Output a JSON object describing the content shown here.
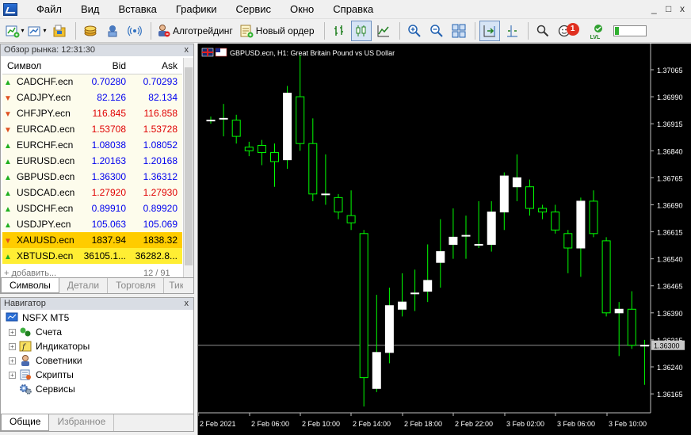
{
  "menu": [
    "Файл",
    "Вид",
    "Вставка",
    "Графики",
    "Сервис",
    "Окно",
    "Справка"
  ],
  "window_controls": [
    "_",
    "□",
    "x"
  ],
  "toolbar": {
    "algo_label": "Алготрейдинг",
    "new_order_label": "Новый ордер",
    "lvl_label": "LVL",
    "notification_count": "1"
  },
  "market_watch": {
    "title": "Обзор рынка: 12:31:30",
    "close": "x",
    "columns": [
      "Символ",
      "Bid",
      "Ask"
    ],
    "rows": [
      {
        "symbol": "CADCHF.ecn",
        "bid": "0.70280",
        "ask": "0.70293",
        "dir": "up",
        "color": "blue"
      },
      {
        "symbol": "CADJPY.ecn",
        "bid": "82.126",
        "ask": "82.134",
        "dir": "down",
        "color": "blue"
      },
      {
        "symbol": "CHFJPY.ecn",
        "bid": "116.845",
        "ask": "116.858",
        "dir": "down",
        "color": "red"
      },
      {
        "symbol": "EURCAD.ecn",
        "bid": "1.53708",
        "ask": "1.53728",
        "dir": "down",
        "color": "red"
      },
      {
        "symbol": "EURCHF.ecn",
        "bid": "1.08038",
        "ask": "1.08052",
        "dir": "up",
        "color": "blue"
      },
      {
        "symbol": "EURUSD.ecn",
        "bid": "1.20163",
        "ask": "1.20168",
        "dir": "up",
        "color": "blue"
      },
      {
        "symbol": "GBPUSD.ecn",
        "bid": "1.36300",
        "ask": "1.36312",
        "dir": "up",
        "color": "blue"
      },
      {
        "symbol": "USDCAD.ecn",
        "bid": "1.27920",
        "ask": "1.27930",
        "dir": "up",
        "color": "red"
      },
      {
        "symbol": "USDCHF.ecn",
        "bid": "0.89910",
        "ask": "0.89920",
        "dir": "up",
        "color": "blue"
      },
      {
        "symbol": "USDJPY.ecn",
        "bid": "105.063",
        "ask": "105.069",
        "dir": "up",
        "color": "blue"
      },
      {
        "symbol": "XAUUSD.ecn",
        "bid": "1837.94",
        "ask": "1838.32",
        "dir": "down",
        "color": "blk",
        "highlight": "xau"
      },
      {
        "symbol": "XBTUSD.ecn",
        "bid": "36105.1...",
        "ask": "36282.8...",
        "dir": "up",
        "color": "blk",
        "highlight": "xbt"
      }
    ],
    "add_label": "+ добавить...",
    "pager": "12 / 91",
    "tabs": [
      "Символы",
      "Детали",
      "Торговля",
      "Тики"
    ]
  },
  "navigator": {
    "title": "Навигатор",
    "close": "x",
    "root": "NSFX MT5",
    "items": [
      "Счета",
      "Индикаторы",
      "Советники",
      "Скрипты",
      "Сервисы"
    ],
    "tabs": [
      "Общие",
      "Избранное"
    ]
  },
  "chart": {
    "title": "GBPUSD.ecn, H1:  Great Britain Pound vs US Dollar",
    "bg_color": "#000000",
    "bull_color": "#ffffff",
    "wick_color": "#00ff00",
    "current_price": "1.36300",
    "price_ticks": [
      "1.37065",
      "1.36990",
      "1.36915",
      "1.36840",
      "1.36765",
      "1.36690",
      "1.36615",
      "1.36540",
      "1.36465",
      "1.36390",
      "1.36315",
      "1.36240",
      "1.36165"
    ],
    "time_ticks": [
      "2 Feb 2021",
      "2 Feb 06:00",
      "2 Feb 10:00",
      "2 Feb 14:00",
      "2 Feb 18:00",
      "2 Feb 22:00",
      "3 Feb 02:00",
      "3 Feb 06:00",
      "3 Feb 10:00"
    ]
  },
  "chart_data": {
    "type": "candlestick",
    "title": "GBPUSD.ecn, H1:  Great Britain Pound vs US Dollar",
    "xlabel": "",
    "ylabel": "",
    "ylim": [
      1.3613,
      1.3712
    ],
    "candles": [
      {
        "o": 1.36925,
        "c": 1.36925,
        "h": 1.36935,
        "l": 1.36915
      },
      {
        "o": 1.3693,
        "c": 1.3693,
        "h": 1.3697,
        "l": 1.3688
      },
      {
        "o": 1.36925,
        "c": 1.3688,
        "h": 1.3694,
        "l": 1.3686
      },
      {
        "o": 1.3685,
        "c": 1.3684,
        "h": 1.36865,
        "l": 1.36825
      },
      {
        "o": 1.36855,
        "c": 1.36835,
        "h": 1.3687,
        "l": 1.368
      },
      {
        "o": 1.36835,
        "c": 1.3681,
        "h": 1.3686,
        "l": 1.3674
      },
      {
        "o": 1.36815,
        "c": 1.37,
        "h": 1.3702,
        "l": 1.3679
      },
      {
        "o": 1.3699,
        "c": 1.3686,
        "h": 1.37105,
        "l": 1.3684
      },
      {
        "o": 1.3686,
        "c": 1.3672,
        "h": 1.3693,
        "l": 1.367
      },
      {
        "o": 1.3672,
        "c": 1.3672,
        "h": 1.3683,
        "l": 1.3669
      },
      {
        "o": 1.3671,
        "c": 1.3667,
        "h": 1.3672,
        "l": 1.3665
      },
      {
        "o": 1.3666,
        "c": 1.3664,
        "h": 1.3673,
        "l": 1.3662
      },
      {
        "o": 1.3661,
        "c": 1.3621,
        "h": 1.3662,
        "l": 1.3613
      },
      {
        "o": 1.3618,
        "c": 1.3628,
        "h": 1.3644,
        "l": 1.3617
      },
      {
        "o": 1.3628,
        "c": 1.3641,
        "h": 1.3646,
        "l": 1.3625
      },
      {
        "o": 1.364,
        "c": 1.3642,
        "h": 1.365,
        "l": 1.3638
      },
      {
        "o": 1.36445,
        "c": 1.36445,
        "h": 1.3651,
        "l": 1.36395
      },
      {
        "o": 1.3645,
        "c": 1.3648,
        "h": 1.3658,
        "l": 1.3642
      },
      {
        "o": 1.3653,
        "c": 1.3656,
        "h": 1.3665,
        "l": 1.3646
      },
      {
        "o": 1.3658,
        "c": 1.366,
        "h": 1.3668,
        "l": 1.3654
      },
      {
        "o": 1.36605,
        "c": 1.36605,
        "h": 1.3666,
        "l": 1.3654
      },
      {
        "o": 1.3658,
        "c": 1.3658,
        "h": 1.367,
        "l": 1.3657
      },
      {
        "o": 1.3658,
        "c": 1.3667,
        "h": 1.367,
        "l": 1.3656
      },
      {
        "o": 1.3667,
        "c": 1.3677,
        "h": 1.3678,
        "l": 1.3662
      },
      {
        "o": 1.3674,
        "c": 1.36765,
        "h": 1.3683,
        "l": 1.367
      },
      {
        "o": 1.3674,
        "c": 1.3668,
        "h": 1.3676,
        "l": 1.3666
      },
      {
        "o": 1.3668,
        "c": 1.3667,
        "h": 1.3669,
        "l": 1.3665
      },
      {
        "o": 1.3667,
        "c": 1.3662,
        "h": 1.3669,
        "l": 1.3661
      },
      {
        "o": 1.3661,
        "c": 1.3657,
        "h": 1.3662,
        "l": 1.365
      },
      {
        "o": 1.3657,
        "c": 1.367,
        "h": 1.3671,
        "l": 1.3649
      },
      {
        "o": 1.367,
        "c": 1.3661,
        "h": 1.3673,
        "l": 1.366
      },
      {
        "o": 1.3659,
        "c": 1.3639,
        "h": 1.366,
        "l": 1.3638
      },
      {
        "o": 1.3639,
        "c": 1.364,
        "h": 1.3642,
        "l": 1.3627
      },
      {
        "o": 1.364,
        "c": 1.363,
        "h": 1.3645,
        "l": 1.3629
      },
      {
        "o": 1.363,
        "c": 1.363,
        "h": 1.36315,
        "l": 1.3619
      }
    ]
  }
}
